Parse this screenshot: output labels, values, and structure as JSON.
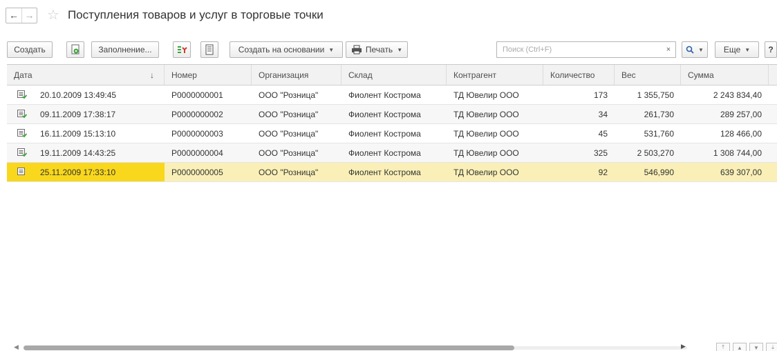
{
  "header": {
    "back_icon": "←",
    "forward_icon": "→",
    "star_icon": "☆",
    "title": "Поступления товаров и услуг в торговые точки"
  },
  "toolbar": {
    "create_label": "Создать",
    "fill_label": "Заполнение...",
    "create_based_label": "Создать на основании",
    "print_label": "Печать",
    "search_placeholder": "Поиск (Ctrl+F)",
    "search_clear": "×",
    "more_label": "Еще",
    "help_label": "?"
  },
  "table": {
    "columns": [
      "Дата",
      "Номер",
      "Организация",
      "Склад",
      "Контрагент",
      "Количество",
      "Вес",
      "Сумма"
    ],
    "sort_indicator": "↓",
    "rows": [
      {
        "date": "20.10.2009 13:49:45",
        "number": "Р0000000001",
        "org": "ООО \"Розница\"",
        "warehouse": "Фиолент Кострома",
        "counterparty": "ТД Ювелир ООО",
        "qty": "173",
        "weight": "1 355,750",
        "sum": "2 243 834,40"
      },
      {
        "date": "09.11.2009 17:38:17",
        "number": "Р0000000002",
        "org": "ООО \"Розница\"",
        "warehouse": "Фиолент Кострома",
        "counterparty": "ТД Ювелир ООО",
        "qty": "34",
        "weight": "261,730",
        "sum": "289 257,00"
      },
      {
        "date": "16.11.2009 15:13:10",
        "number": "Р0000000003",
        "org": "ООО \"Розница\"",
        "warehouse": "Фиолент Кострома",
        "counterparty": "ТД Ювелир ООО",
        "qty": "45",
        "weight": "531,760",
        "sum": "128 466,00"
      },
      {
        "date": "19.11.2009 14:43:25",
        "number": "Р0000000004",
        "org": "ООО \"Розница\"",
        "warehouse": "Фиолент Кострома",
        "counterparty": "ТД Ювелир ООО",
        "qty": "325",
        "weight": "2 503,270",
        "sum": "1 308 744,00"
      },
      {
        "date": "25.11.2009 17:33:10",
        "number": "Р0000000005",
        "org": "ООО \"Розница\"",
        "warehouse": "Фиолент Кострома",
        "counterparty": "ТД Ювелир ООО",
        "qty": "92",
        "weight": "546,990",
        "sum": "639 307,00"
      }
    ],
    "selected_row": 4
  },
  "colors": {
    "selected_row": "#faf0b7",
    "selected_date_cell": "#f9d71c",
    "header_bg": "#f2f2f2",
    "doc_icon_green": "#3aa63a"
  }
}
